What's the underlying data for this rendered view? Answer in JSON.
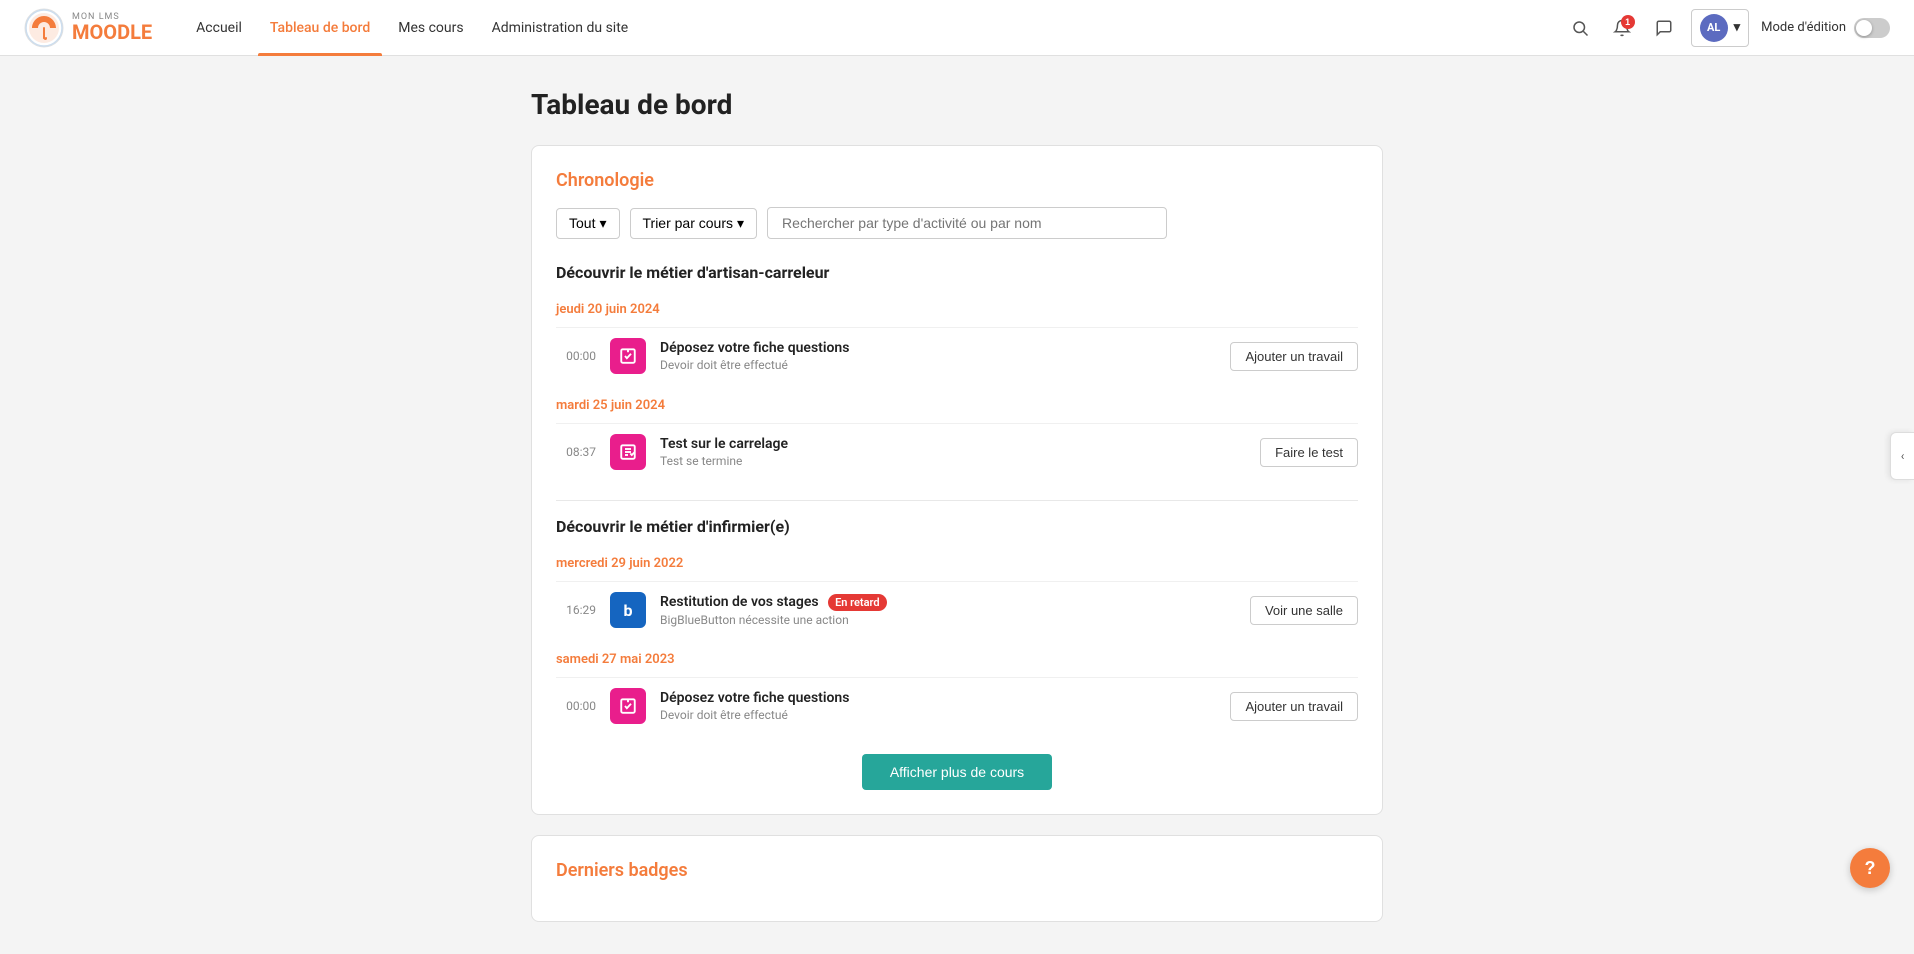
{
  "brand": {
    "top_label": "MON LMS",
    "bottom_label": "MOODLE"
  },
  "navbar": {
    "items": [
      {
        "label": "Accueil",
        "active": false
      },
      {
        "label": "Tableau de bord",
        "active": true
      },
      {
        "label": "Mes cours",
        "active": false
      },
      {
        "label": "Administration du site",
        "active": false
      }
    ],
    "mode_edition_label": "Mode d'édition",
    "user_initials": "AL",
    "user_menu_arrow": "▾",
    "notification_count": "1"
  },
  "page": {
    "title": "Tableau de bord"
  },
  "chronologie": {
    "section_title": "Chronologie",
    "filter_all": "Tout",
    "filter_all_arrow": "▾",
    "filter_sort": "Trier par cours",
    "filter_sort_arrow": "▾",
    "search_placeholder": "Rechercher par type d'activité ou par nom"
  },
  "courses": [
    {
      "title": "Découvrir le métier d'artisan-carreleur",
      "dates": [
        {
          "label": "jeudi 20 juin 2024",
          "activities": [
            {
              "time": "00:00",
              "icon_type": "pink",
              "icon_symbol": "⬇",
              "name": "Déposez votre fiche questions",
              "subtitle": "Devoir doit être effectué",
              "action_label": "Ajouter un travail",
              "badge": null
            }
          ]
        },
        {
          "label": "mardi 25 juin 2024",
          "activities": [
            {
              "time": "08:37",
              "icon_type": "pink",
              "icon_symbol": "✎",
              "name": "Test sur le carrelage",
              "subtitle": "Test se termine",
              "action_label": "Faire le test",
              "badge": null
            }
          ]
        }
      ]
    },
    {
      "title": "Découvrir le métier d'infirmier(e)",
      "dates": [
        {
          "label": "mercredi 29 juin 2022",
          "activities": [
            {
              "time": "16:29",
              "icon_type": "blue",
              "icon_symbol": "b",
              "name": "Restitution de vos stages",
              "subtitle": "BigBlueButton nécessite une action",
              "action_label": "Voir une salle",
              "badge": "En retard"
            }
          ]
        },
        {
          "label": "samedi 27 mai 2023",
          "activities": [
            {
              "time": "00:00",
              "icon_type": "pink",
              "icon_symbol": "⬇",
              "name": "Déposez votre fiche questions",
              "subtitle": "Devoir doit être effectué",
              "action_label": "Ajouter un travail",
              "badge": null
            }
          ]
        }
      ]
    }
  ],
  "show_more_label": "Afficher plus de cours",
  "derniers_badges": {
    "title": "Derniers badges"
  },
  "sidebar_toggle": "‹",
  "help_label": "?"
}
